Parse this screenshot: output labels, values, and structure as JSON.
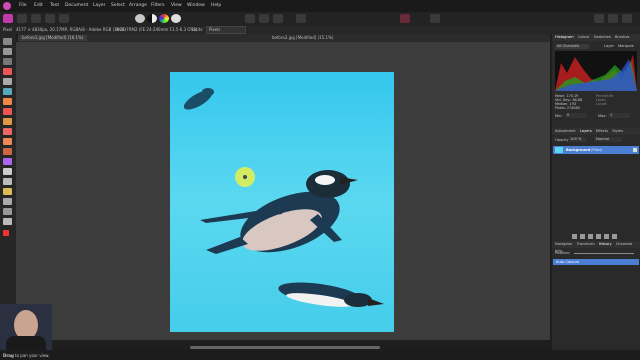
{
  "menu": [
    "File",
    "Edit",
    "Text",
    "Document",
    "Layer",
    "Select",
    "Arrange",
    "Filters",
    "View",
    "Window",
    "Help"
  ],
  "context_bar": {
    "persona_label": "Pixel",
    "doc_info": "4177 × 4830px, 20.17MP, RGBA/8 - Adobe RGB (1998)",
    "camera_info": "ILCE-7RM2 (FE 24-240mm F3.5-6.3 OSS)",
    "units_label": "Units:",
    "units_value": "Pixels"
  },
  "tabs": [
    {
      "label": "before1.jpg [Modified] (16.1%)"
    },
    {
      "label": "before2.jpg [Modified] (15.1%)"
    }
  ],
  "right_panel": {
    "histogram_tabs": [
      "Histogram",
      "Colour",
      "Swatches",
      "Brushes"
    ],
    "channel_select": "All Channels",
    "layer_option": "Layer",
    "marquee_option": "Marquee",
    "stats": [
      "Mean: 170.19",
      "Std. Dev.: 66.88",
      "Median: 193",
      "Pixels: 274080"
    ],
    "stats_right": [
      "Percentile:",
      "Level:",
      "Count:"
    ],
    "min_label": "Min:",
    "min_value": "0",
    "max_label": "Max:",
    "max_value": "1",
    "layer_tabs": [
      "Adjustment",
      "Layers",
      "Effects",
      "Styles"
    ],
    "opacity_label": "Opacity:",
    "opacity_value": "100 %",
    "blend_mode": "Normal",
    "layer_name": "Background",
    "layer_kind": "(Pixel)",
    "history_tabs": [
      "Navigator",
      "Transform",
      "History",
      "Channels",
      "Info"
    ],
    "history_position_label": "Position:",
    "history_items": [
      "Auto Colours"
    ]
  },
  "status": {
    "hint_bold": "Drag",
    "hint_text": "to pan your view."
  },
  "colors": {
    "accent": "#4a7fd4",
    "water": "#3fd0f0",
    "cursor_ring": "#e8f04a"
  }
}
